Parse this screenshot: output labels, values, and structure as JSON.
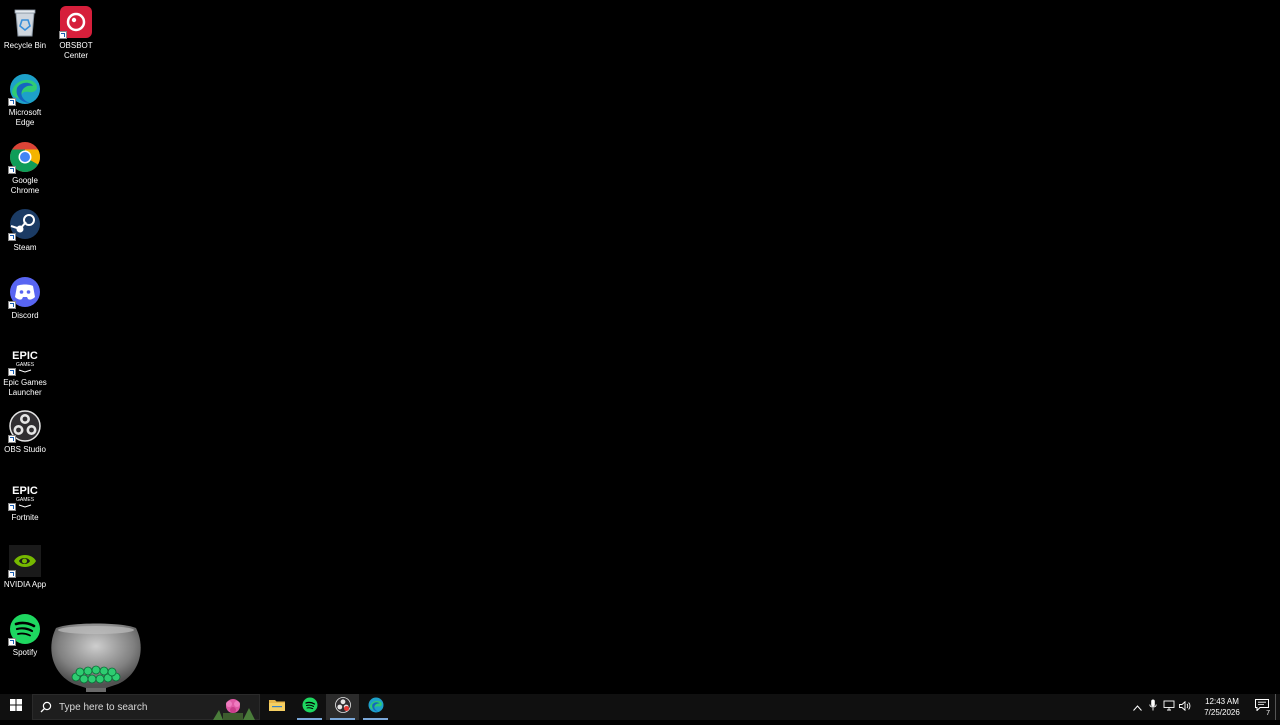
{
  "desktop": {
    "icons": [
      {
        "label": "Recycle Bin",
        "icon": "recycle-bin-icon"
      },
      {
        "label": "OBSBOT Center",
        "icon": "obsbot-icon"
      },
      {
        "label": "Microsoft Edge",
        "icon": "edge-icon"
      },
      {
        "label": "Google Chrome",
        "icon": "chrome-icon"
      },
      {
        "label": "Steam",
        "icon": "steam-icon"
      },
      {
        "label": "Discord",
        "icon": "discord-icon"
      },
      {
        "label": "Epic Games Launcher",
        "icon": "epic-games-icon"
      },
      {
        "label": "OBS Studio",
        "icon": "obs-studio-icon"
      },
      {
        "label": "Fortnite",
        "icon": "epic-games-icon"
      },
      {
        "label": "NVIDIA App",
        "icon": "nvidia-icon"
      },
      {
        "label": "Spotify",
        "icon": "spotify-icon"
      }
    ]
  },
  "taskbar": {
    "search_placeholder": "Type here to search",
    "apps": [
      {
        "name": "File Explorer",
        "icon": "folder-icon"
      },
      {
        "name": "Spotify",
        "icon": "spotify-icon"
      },
      {
        "name": "OBS Studio",
        "icon": "obs-studio-icon"
      },
      {
        "name": "Microsoft Edge",
        "icon": "edge-icon"
      }
    ],
    "clock": {
      "time": "12:43 AM",
      "date": "7/25/2026"
    },
    "notification_count": "7"
  },
  "colors": {
    "background": "#000000",
    "taskbar": "#101010",
    "active_indicator": "#7aa7d8"
  }
}
